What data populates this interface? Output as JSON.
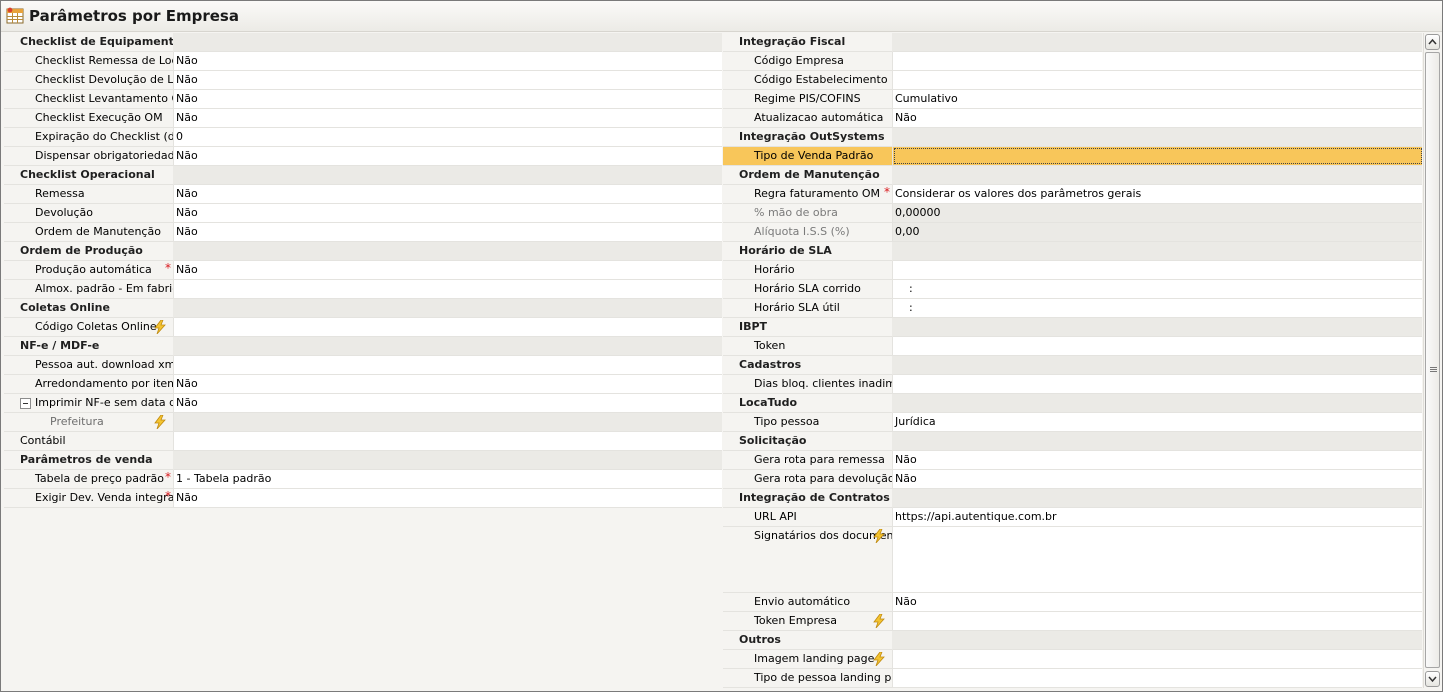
{
  "window": {
    "title": "Parâmetros por Empresa",
    "icon": "table-grid-icon"
  },
  "left": [
    {
      "type": "cat",
      "label": "Checklist de Equipamento"
    },
    {
      "type": "prop",
      "label": "Checklist Remessa de Locação",
      "value": "Não"
    },
    {
      "type": "prop",
      "label": "Checklist Devolução de Locação",
      "value": "Não"
    },
    {
      "type": "prop",
      "label": "Checklist Levantamento OM",
      "value": "Não"
    },
    {
      "type": "prop",
      "label": "Checklist Execução OM",
      "value": "Não"
    },
    {
      "type": "prop",
      "label": "Expiração do Checklist (dias)",
      "value": "0"
    },
    {
      "type": "prop",
      "label": "Dispensar obrigatoriedade",
      "value": "Não"
    },
    {
      "type": "cat",
      "label": "Checklist Operacional"
    },
    {
      "type": "prop",
      "label": "Remessa",
      "value": "Não"
    },
    {
      "type": "prop",
      "label": "Devolução",
      "value": "Não"
    },
    {
      "type": "prop",
      "label": "Ordem de Manutenção",
      "value": "Não"
    },
    {
      "type": "cat",
      "label": "Ordem de Produção"
    },
    {
      "type": "prop",
      "label": "Produção automática",
      "value": "Não",
      "required": true
    },
    {
      "type": "prop",
      "label": "Almox. padrão - Em fabricação",
      "value": ""
    },
    {
      "type": "cat",
      "label": "Coletas Online"
    },
    {
      "type": "prop",
      "label": "Código Coletas Online",
      "value": "",
      "icon": "lightning-icon"
    },
    {
      "type": "cat",
      "label": "NF-e / MDF-e"
    },
    {
      "type": "prop",
      "label": "Pessoa aut. download xml",
      "value": ""
    },
    {
      "type": "prop",
      "label": "Arredondamento por item no total",
      "value": "Não"
    },
    {
      "type": "prop",
      "label": "Imprimir NF-e sem data de Emissão",
      "value": "Não",
      "expander": true
    },
    {
      "type": "sub",
      "label": "Prefeitura",
      "value": "",
      "icon": "lightning-icon"
    },
    {
      "type": "plain",
      "label": "Contábil",
      "value": ""
    },
    {
      "type": "cat",
      "label": "Parâmetros de venda"
    },
    {
      "type": "prop",
      "label": "Tabela de preço padrão",
      "value": "1 - Tabela padrão",
      "required": true
    },
    {
      "type": "prop",
      "label": "Exigir Dev. Venda integral (NF)",
      "value": "Não",
      "required": true
    }
  ],
  "right": [
    {
      "type": "cat",
      "label": "Integração Fiscal"
    },
    {
      "type": "prop",
      "label": "Código Empresa",
      "value": ""
    },
    {
      "type": "prop",
      "label": "Código Estabelecimento",
      "value": ""
    },
    {
      "type": "prop",
      "label": "Regime PIS/COFINS",
      "value": "Cumulativo"
    },
    {
      "type": "prop",
      "label": "Atualizacao automática",
      "value": "Não"
    },
    {
      "type": "cat",
      "label": "Integração OutSystems"
    },
    {
      "type": "prop",
      "label": "Tipo de Venda Padrão",
      "value": "",
      "selected": true
    },
    {
      "type": "cat",
      "label": "Ordem de Manutenção"
    },
    {
      "type": "prop",
      "label": "Regra faturamento OM",
      "value": "Considerar os valores dos parâmetros gerais",
      "required": true
    },
    {
      "type": "disabled",
      "label": "% mão de obra",
      "value": "0,00000"
    },
    {
      "type": "disabled",
      "label": "Alíquota I.S.S (%)",
      "value": "0,00"
    },
    {
      "type": "cat",
      "label": "Horário de SLA"
    },
    {
      "type": "prop",
      "label": "Horário",
      "value": ""
    },
    {
      "type": "prop",
      "label": "Horário SLA corrido",
      "value": "    :"
    },
    {
      "type": "prop",
      "label": "Horário SLA útil",
      "value": "    :"
    },
    {
      "type": "cat",
      "label": "IBPT"
    },
    {
      "type": "prop",
      "label": "Token",
      "value": ""
    },
    {
      "type": "cat",
      "label": "Cadastros"
    },
    {
      "type": "prop",
      "label": "Dias bloq. clientes inadimplentes",
      "value": ""
    },
    {
      "type": "cat",
      "label": "LocaTudo"
    },
    {
      "type": "prop",
      "label": "Tipo pessoa",
      "value": "Jurídica"
    },
    {
      "type": "cat",
      "label": "Solicitação"
    },
    {
      "type": "prop",
      "label": "Gera rota para remessa",
      "value": "Não"
    },
    {
      "type": "prop",
      "label": "Gera rota para devolução",
      "value": "Não"
    },
    {
      "type": "cat",
      "label": "Integração de Contratos"
    },
    {
      "type": "prop",
      "label": "URL API",
      "value": "https://api.autentique.com.br"
    },
    {
      "type": "prop",
      "label": "Signatários dos documentos",
      "value": "",
      "icon": "lightning-icon",
      "tall": true
    },
    {
      "type": "prop",
      "label": "Envio automático",
      "value": "Não"
    },
    {
      "type": "prop",
      "label": "Token Empresa",
      "value": "",
      "icon": "lightning-icon"
    },
    {
      "type": "cat",
      "label": "Outros"
    },
    {
      "type": "prop",
      "label": "Imagem landing page",
      "value": "",
      "icon": "lightning-icon"
    },
    {
      "type": "prop",
      "label": "Tipo de pessoa landing page",
      "value": ""
    }
  ],
  "colors": {
    "selection": "#f8c65a",
    "required": "#d9171c",
    "category_bg": "#ebeae6"
  }
}
